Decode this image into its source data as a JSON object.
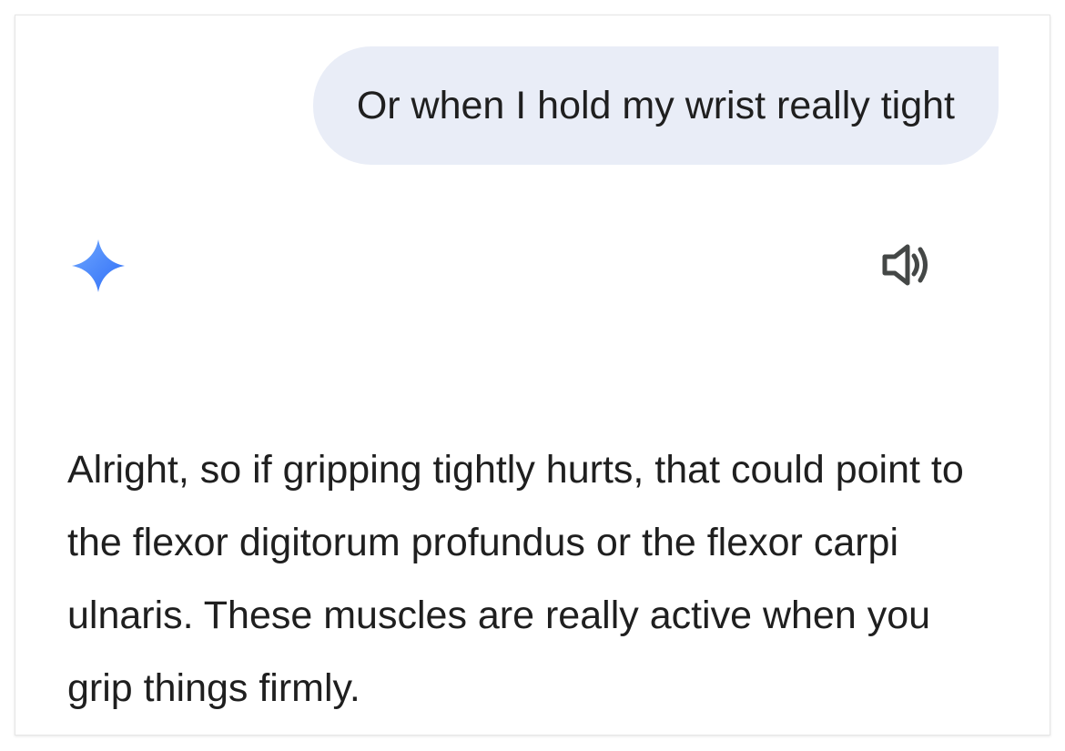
{
  "conversation": {
    "user_message": "Or when I hold my wrist really tight",
    "assistant_icon": "gemini-sparkle-icon",
    "speaker_icon": "speaker-volume-icon",
    "assistant_response": "Alright, so if gripping tightly hurts, that could point to the flexor digitorum profundus or the flexor carpi ulnaris. These muscles are really active when you grip things firmly."
  },
  "colors": {
    "user_bubble_bg": "#e9edf7",
    "text": "#1f1f1f",
    "sparkle_light": "#6fa8ff",
    "sparkle_dark": "#2f6df6",
    "icon": "#444746"
  }
}
